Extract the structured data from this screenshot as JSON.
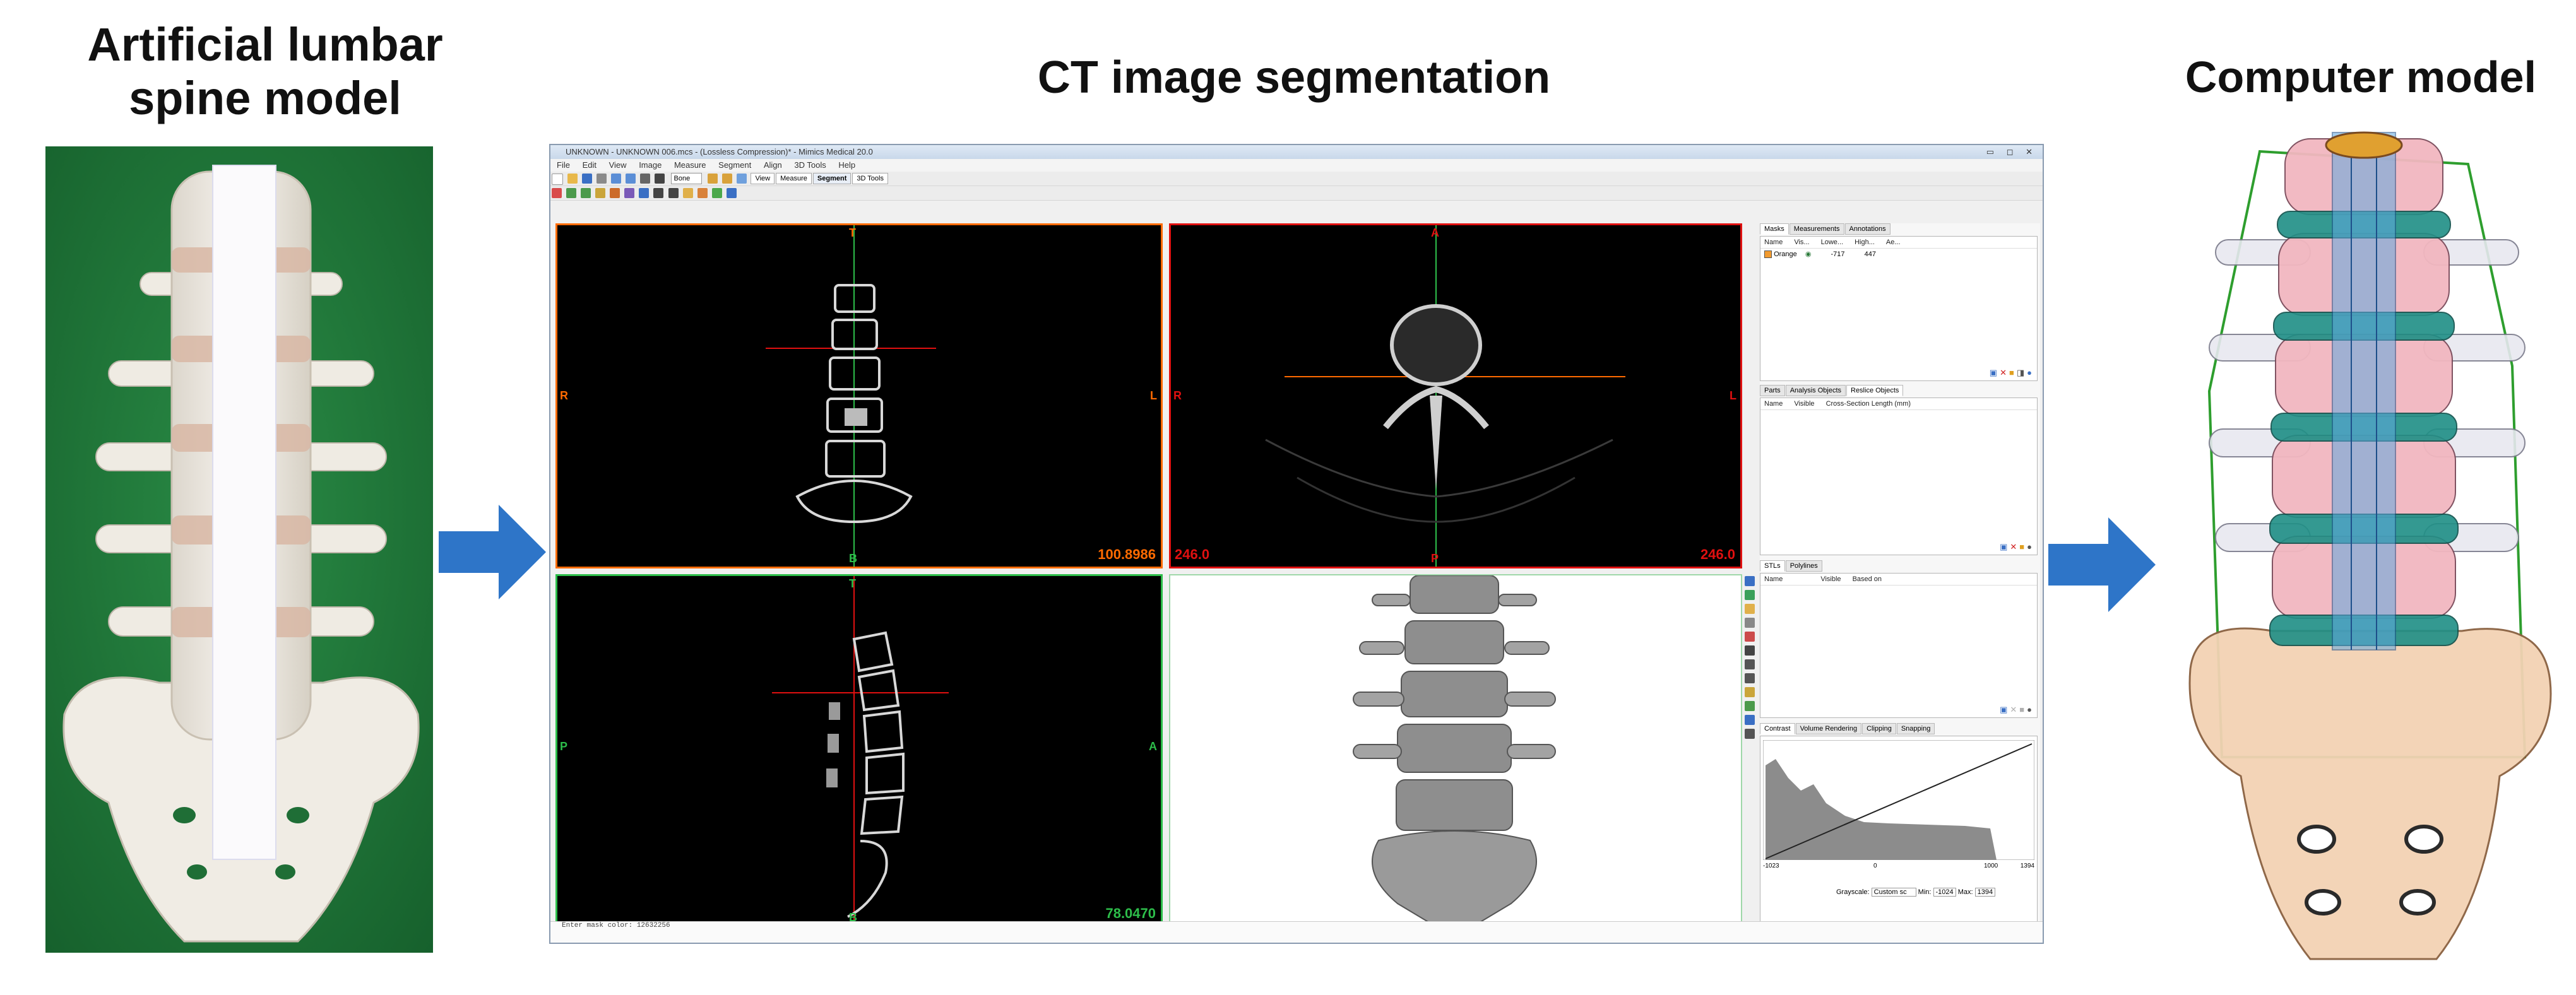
{
  "titles": {
    "left_line1": "Artificial lumbar",
    "left_line2": "spine model",
    "center": "CT image segmentation",
    "right": "Computer model"
  },
  "software": {
    "window_title": "UNKNOWN - UNKNOWN 006.mcs - (Lossless Compression)* - Mimics Medical 20.0",
    "menu": [
      "File",
      "Edit",
      "View",
      "Image",
      "Measure",
      "Segment",
      "Align",
      "3D Tools",
      "Help"
    ],
    "toolbar_dropdown": "Bone",
    "view_tabs": [
      "View",
      "Measure",
      "Segment",
      "3D Tools"
    ],
    "active_view_tab": "Segment",
    "viewports": {
      "coronal": {
        "top": "T",
        "bottom": "B",
        "left": "R",
        "right": "L",
        "value": "100.8986",
        "border_color": "#ff6a00"
      },
      "axial": {
        "top": "A",
        "bottom": "P",
        "left": "R",
        "right": "L",
        "value_left": "246.0",
        "value_right": "246.0",
        "border_color": "#e01010"
      },
      "sagittal": {
        "top": "T",
        "bottom": "B",
        "left": "P",
        "right": "A",
        "value": "78.0470",
        "border_color": "#2dbd4a"
      }
    },
    "masks_panel": {
      "tabs": [
        "Masks",
        "Measurements",
        "Annotations"
      ],
      "columns": [
        "Name",
        "Vis...",
        "Lowe...",
        "High...",
        "Ae..."
      ],
      "row": {
        "name": "Orange",
        "lower": "-717",
        "higher": "447"
      }
    },
    "parts_panel": {
      "tabs": [
        "Parts",
        "Analysis Objects",
        "Reslice Objects"
      ],
      "columns": [
        "Name",
        "Visible",
        "Cross-Section Length (mm)"
      ]
    },
    "stl_panel": {
      "tabs": [
        "STLs",
        "Polylines"
      ],
      "columns": [
        "Name",
        "Visible",
        "Based on"
      ]
    },
    "contrast_panel": {
      "tabs": [
        "Contrast",
        "Volume Rendering",
        "Clipping",
        "Snapping"
      ],
      "ticks": [
        "-1023",
        "0",
        "1000",
        "1394"
      ],
      "grayscale_label": "Grayscale:",
      "grayscale_value": "Custom sc",
      "min_label": "Min:",
      "min_value": "-1024",
      "max_label": "Max:",
      "max_value": "1394"
    },
    "status_text": "Enter mask color: 12632256"
  },
  "colors": {
    "arrow": "#2e75c8",
    "background_green": "#1f7a3a",
    "titlebar": "#c9d8ea"
  }
}
